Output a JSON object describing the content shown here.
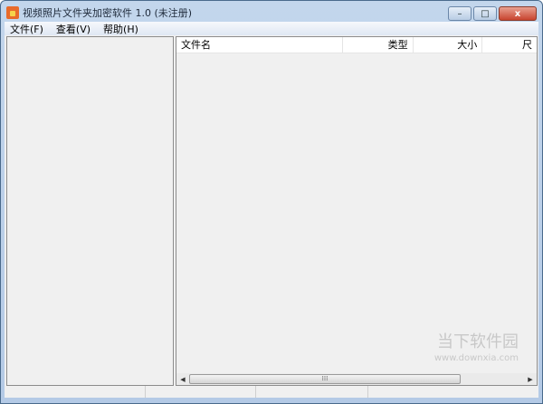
{
  "window": {
    "title": "视频照片文件夹加密软件 1.0 (未注册)",
    "minimize": "–",
    "maximize": "□",
    "close": "x"
  },
  "menu": [
    "文件(F)",
    "查看(V)",
    "帮助(H)"
  ],
  "list": {
    "columns": [
      "文件名",
      "类型",
      "大小",
      "尺"
    ],
    "scroll_grip": "⁞⁞⁞"
  },
  "watermark": {
    "name": "当下软件园",
    "url": "www.downxia.com"
  }
}
